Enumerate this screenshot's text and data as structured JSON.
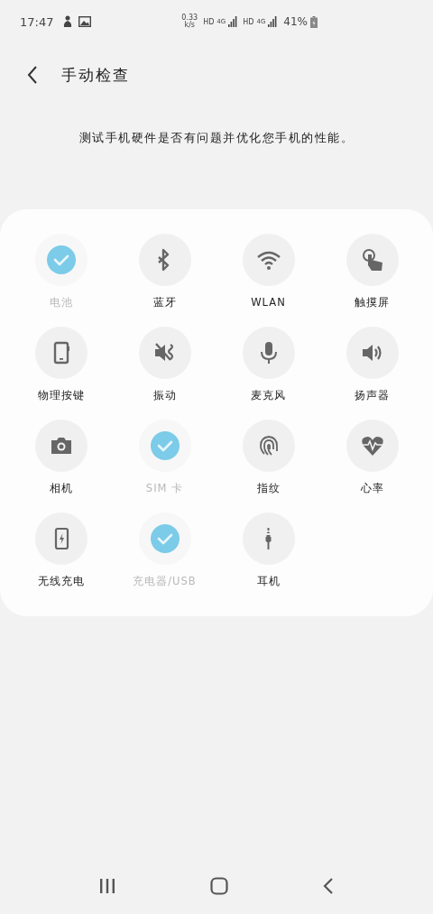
{
  "status_bar": {
    "time": "17:47",
    "speed": [
      "0.33",
      "k/s"
    ],
    "sims": [
      {
        "type": "HD",
        "network": "4G"
      },
      {
        "type": "HD",
        "network": "4G"
      }
    ],
    "battery": "41%"
  },
  "header": {
    "title": "手动检查"
  },
  "description": "测试手机硬件是否有问题并优化您手机的性能。",
  "tests": [
    {
      "label": "电池",
      "checked": true
    },
    {
      "label": "蓝牙",
      "checked": false
    },
    {
      "label": "WLAN",
      "checked": false
    },
    {
      "label": "触摸屏",
      "checked": false
    },
    {
      "label": "物理按键",
      "checked": false
    },
    {
      "label": "振动",
      "checked": false
    },
    {
      "label": "麦克风",
      "checked": false
    },
    {
      "label": "扬声器",
      "checked": false
    },
    {
      "label": "相机",
      "checked": false
    },
    {
      "label": "SIM 卡",
      "checked": true
    },
    {
      "label": "指纹",
      "checked": false
    },
    {
      "label": "心率",
      "checked": false
    },
    {
      "label": "无线充电",
      "checked": false
    },
    {
      "label": "充电器/USB",
      "checked": true
    },
    {
      "label": "耳机",
      "checked": false
    }
  ]
}
